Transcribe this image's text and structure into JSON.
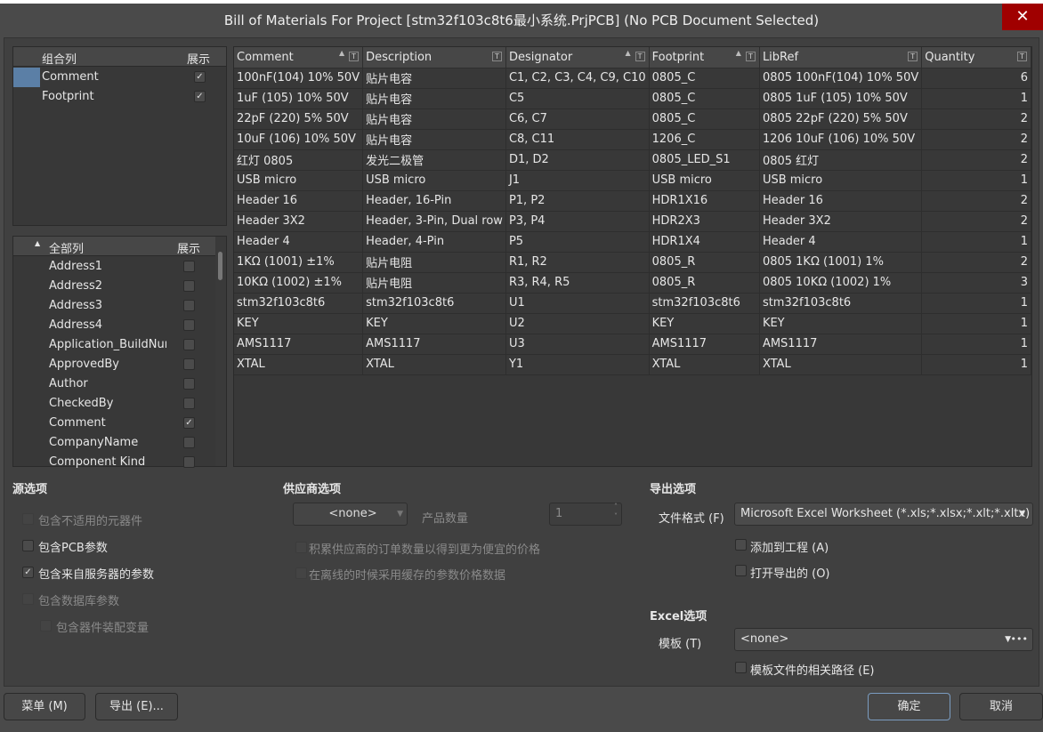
{
  "window": {
    "title": "Bill of Materials For Project [stm32f103c8t6最小系统.PrjPCB] (No PCB Document Selected)",
    "close_icon": "close-icon",
    "close_color": "#a00000"
  },
  "group_columns": {
    "header": "组合列",
    "show_header": "展示",
    "items": [
      {
        "label": "Comment",
        "checked": true
      },
      {
        "label": "Footprint",
        "checked": true
      }
    ]
  },
  "all_columns": {
    "header": "全部列",
    "show_header": "展示",
    "items": [
      {
        "label": "Address1",
        "checked": false
      },
      {
        "label": "Address2",
        "checked": false
      },
      {
        "label": "Address3",
        "checked": false
      },
      {
        "label": "Address4",
        "checked": false
      },
      {
        "label": "Application_BuildNum",
        "checked": false
      },
      {
        "label": "ApprovedBy",
        "checked": false
      },
      {
        "label": "Author",
        "checked": false
      },
      {
        "label": "CheckedBy",
        "checked": false
      },
      {
        "label": "Comment",
        "checked": true
      },
      {
        "label": "CompanyName",
        "checked": false
      },
      {
        "label": "Component Kind",
        "checked": false
      }
    ]
  },
  "table": {
    "columns": [
      "Comment",
      "Description",
      "Designator",
      "Footprint",
      "LibRef",
      "Quantity"
    ],
    "sorted": [
      true,
      false,
      true,
      true,
      false,
      false
    ],
    "rows": [
      [
        "100nF(104) 10% 50V",
        "贴片电容",
        "C1, C2, C3, C4, C9, C10",
        "0805_C",
        "0805 100nF(104) 10% 50V",
        "6"
      ],
      [
        "1uF (105) 10% 50V",
        "贴片电容",
        "C5",
        "0805_C",
        "0805 1uF (105) 10% 50V",
        "1"
      ],
      [
        "22pF (220) 5% 50V",
        "贴片电容",
        "C6, C7",
        "0805_C",
        "0805 22pF (220) 5% 50V",
        "2"
      ],
      [
        "10uF (106) 10% 50V",
        "贴片电容",
        "C8, C11",
        "1206_C",
        "1206 10uF (106) 10% 50V",
        "2"
      ],
      [
        "红灯 0805",
        "发光二极管",
        "D1, D2",
        "0805_LED_S1",
        "0805 红灯",
        "2"
      ],
      [
        "USB micro",
        "USB micro",
        "J1",
        "USB micro",
        "USB micro",
        "1"
      ],
      [
        "Header 16",
        "Header, 16-Pin",
        "P1, P2",
        "HDR1X16",
        "Header 16",
        "2"
      ],
      [
        "Header 3X2",
        "Header, 3-Pin, Dual row",
        "P3, P4",
        "HDR2X3",
        "Header 3X2",
        "2"
      ],
      [
        "Header 4",
        "Header, 4-Pin",
        "P5",
        "HDR1X4",
        "Header 4",
        "1"
      ],
      [
        "1KΩ (1001) ±1%",
        "贴片电阻",
        "R1, R2",
        "0805_R",
        "0805 1KΩ (1001) 1%",
        "2"
      ],
      [
        "10KΩ (1002) ±1%",
        "贴片电阻",
        "R3, R4, R5",
        "0805_R",
        "0805 10KΩ (1002) 1%",
        "3"
      ],
      [
        "stm32f103c8t6",
        "stm32f103c8t6",
        "U1",
        "stm32f103c8t6",
        "stm32f103c8t6",
        "1"
      ],
      [
        "KEY",
        "KEY",
        "U2",
        "KEY",
        "KEY",
        "1"
      ],
      [
        "AMS1117",
        "AMS1117",
        "U3",
        "AMS1117",
        "AMS1117",
        "1"
      ],
      [
        "XTAL",
        "XTAL",
        "Y1",
        "XTAL",
        "XTAL",
        "1"
      ]
    ]
  },
  "source": {
    "title": "源选项",
    "options": [
      {
        "label": "包含不适用的元器件",
        "checked": false,
        "disabled": true
      },
      {
        "label": "包含PCB参数",
        "checked": false,
        "disabled": false
      },
      {
        "label": "包含来自服务器的参数",
        "checked": true,
        "disabled": false
      },
      {
        "label": "包含数据库参数",
        "checked": false,
        "disabled": true
      },
      {
        "label": "包含器件装配变量",
        "checked": false,
        "disabled": true
      }
    ]
  },
  "supplier": {
    "title": "供应商选项",
    "supplier_value": "<none>",
    "qty_label": "产品数量",
    "qty_value": "1",
    "opt1": "积累供应商的订单数量以得到更为便宜的价格",
    "opt2": "在离线的时候采用缓存的参数价格数据"
  },
  "export": {
    "title": "导出选项",
    "format_label": "文件格式 (F)",
    "format_value": "Microsoft Excel Worksheet (*.xls;*.xlsx;*.xlt;*.xltx)",
    "add_to_project": "添加到工程 (A)",
    "open_exported": "打开导出的 (O)"
  },
  "excel": {
    "title": "Excel选项",
    "template_label": "模板 (T)",
    "template_value": "<none>",
    "relative_path": "模板文件的相关路径 (E)"
  },
  "footer": {
    "menu": "菜单 (M)",
    "export": "导出 (E)...",
    "ok": "确定",
    "cancel": "取消"
  }
}
